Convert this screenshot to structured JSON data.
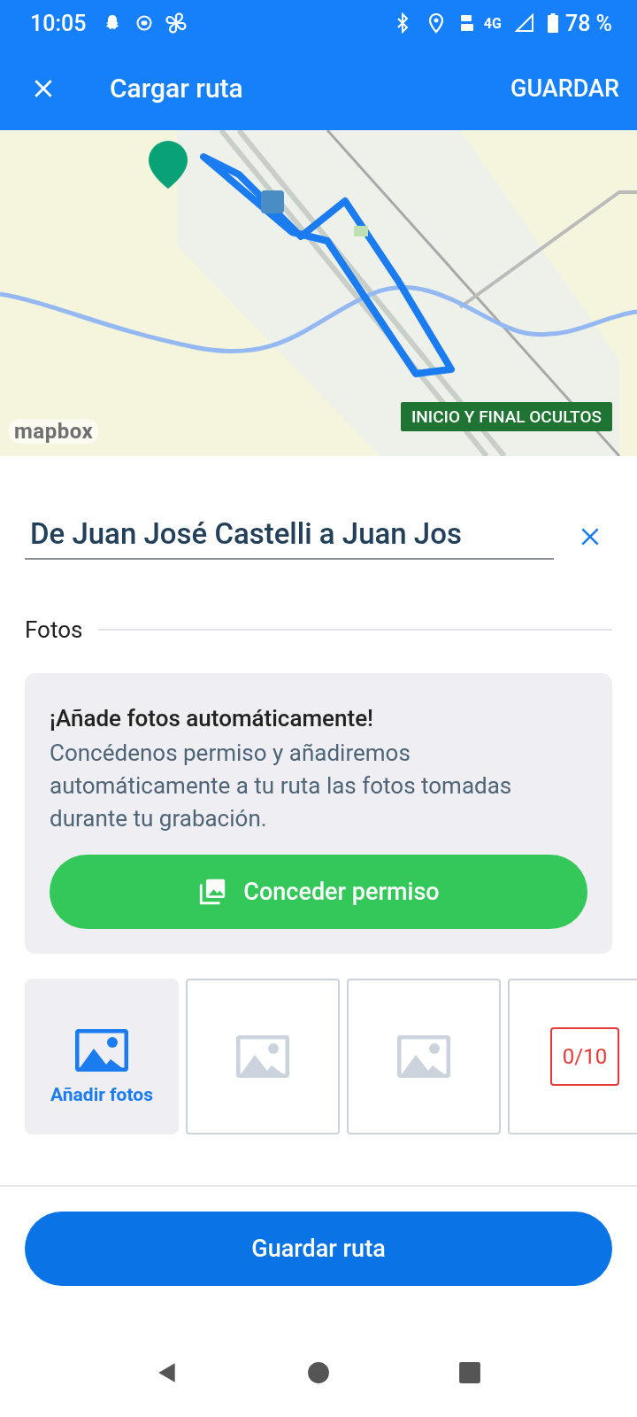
{
  "status_bar": {
    "time": "10:05",
    "network": "4G",
    "battery": "78 %"
  },
  "app_bar": {
    "title": "Cargar ruta",
    "action": "GUARDAR"
  },
  "map": {
    "kind": "picture",
    "badge": "INICIO Y FINAL OCULTOS",
    "attribution": "mapbox"
  },
  "route_name": {
    "value": "De Juan José Castelli a Juan Jos"
  },
  "photos_section": {
    "heading": "Fotos",
    "permission_card": {
      "title": "¡Añade fotos automáticamente!",
      "body": "Concédenos permiso y añadiremos automáticamente a tu ruta las fotos tomadas durante tu grabación.",
      "button": "Conceder permiso"
    },
    "slots": [
      {
        "kind": "add",
        "label": "Añadir fotos"
      },
      {
        "kind": "empty"
      },
      {
        "kind": "empty"
      },
      {
        "kind": "counter",
        "label": "0/10"
      }
    ]
  },
  "save_button": "Guardar ruta"
}
